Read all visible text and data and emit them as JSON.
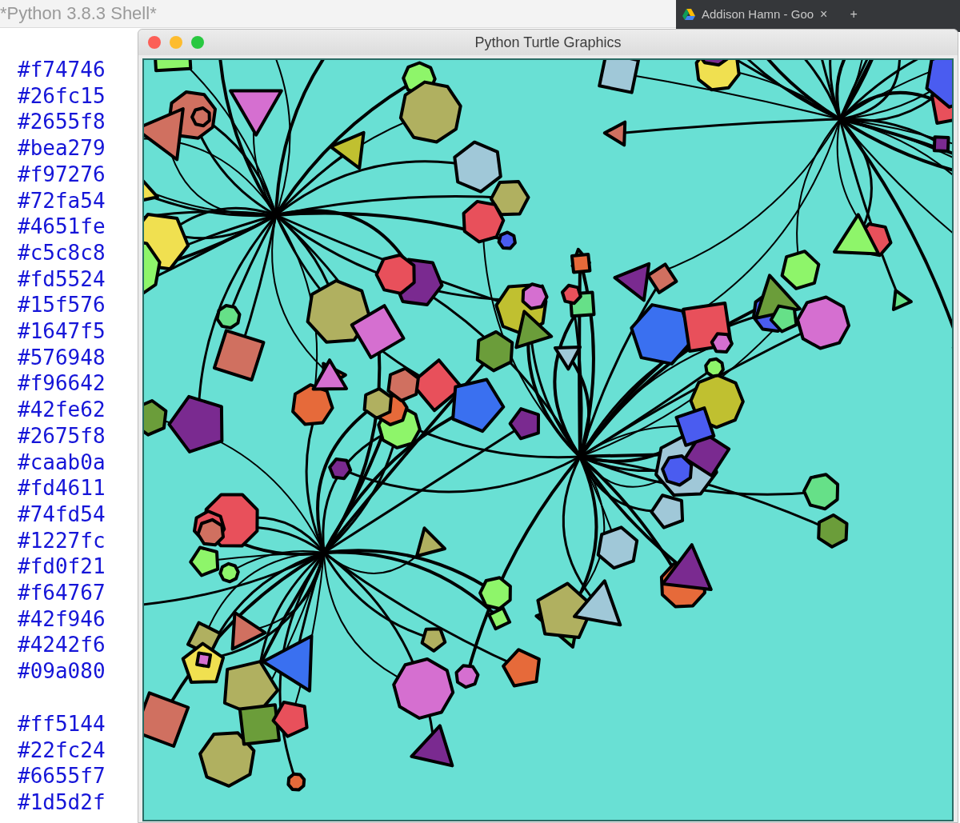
{
  "shell": {
    "title": "*Python 3.8.3 Shell*",
    "output_blocks": [
      [
        "#f74746",
        "#26fc15",
        "#2655f8",
        "#bea279",
        "#f97276",
        "#72fa54",
        "#4651fe",
        "#c5c8c8",
        "#fd5524",
        "#15f576",
        "#1647f5",
        "#576948",
        "#f96642",
        "#42fe62",
        "#2675f8",
        "#caab0a",
        "#fd4611",
        "#74fd54",
        "#1227fc",
        "#fd0f21",
        "#f64767",
        "#42f946",
        "#4242f6",
        "#09a080"
      ],
      [
        "#ff5144",
        "#22fc24",
        "#6655f7",
        "#1d5d2f"
      ]
    ]
  },
  "browser_tab": {
    "label": "Addison Hamn - Goo",
    "close": "×",
    "new_tab": "+"
  },
  "turtle_window": {
    "title": "Python Turtle Graphics"
  }
}
